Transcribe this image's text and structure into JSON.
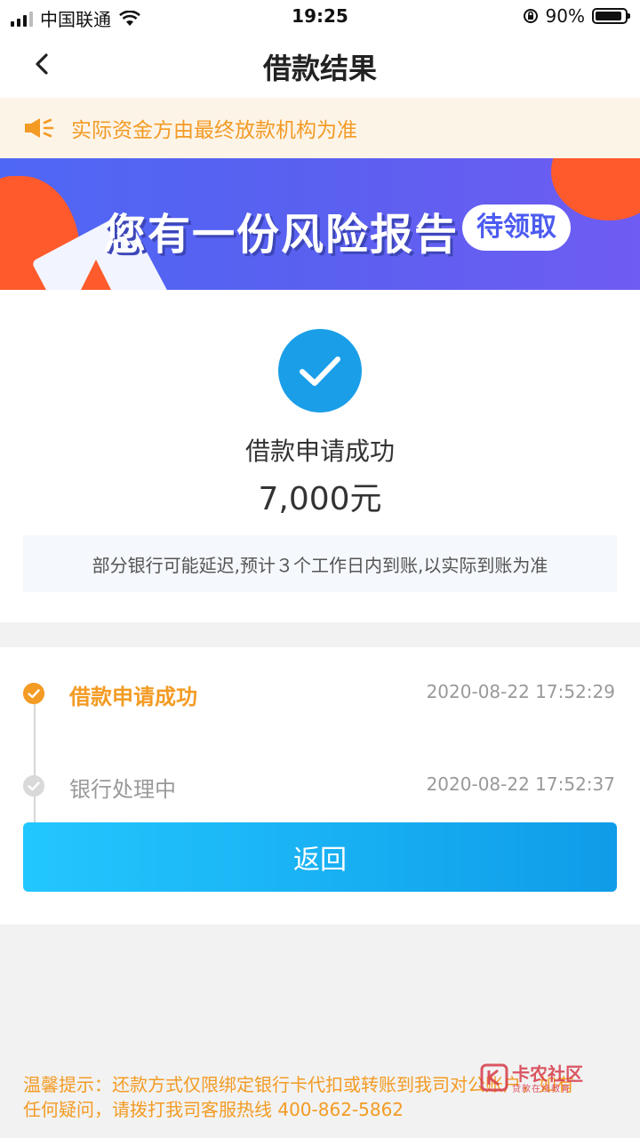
{
  "status_bar": {
    "carrier": "中国联通",
    "time": "19:25",
    "battery": "90%",
    "battery_level": 0.9
  },
  "nav": {
    "title": "借款结果",
    "back_icon": "chevron-left-icon"
  },
  "notice": {
    "icon": "speaker-icon",
    "text": "实际资金方由最终放款机构为准"
  },
  "banner": {
    "headline": "您有一份风险报告",
    "pill": "待领取"
  },
  "result": {
    "icon": "checkmark-circle-icon",
    "status": "借款申请成功",
    "amount": "7,000元",
    "hint": "部分银行可能延迟,预计３个工作日内到账,以实际到账为准"
  },
  "timeline": {
    "steps": [
      {
        "label": "借款申请成功",
        "time": "2020-08-22 17:52:29",
        "state": "done"
      },
      {
        "label": "银行处理中",
        "time": "2020-08-22 17:52:37",
        "state": "pending"
      }
    ]
  },
  "actions": {
    "return_label": "返回"
  },
  "footer": {
    "line1": "温馨提示：还款方式仅限绑定银行卡代扣或转账到我司对公账户，如有",
    "line2": "任何疑问，请拨打我司客服热线 400-862-5862"
  },
  "watermark": {
    "text": "卡农社区",
    "sub": "贷款在线教育"
  },
  "colors": {
    "accent_orange": "#f39b24",
    "primary_blue": "#1a9ee8",
    "banner_purple": "#5a60f0"
  }
}
